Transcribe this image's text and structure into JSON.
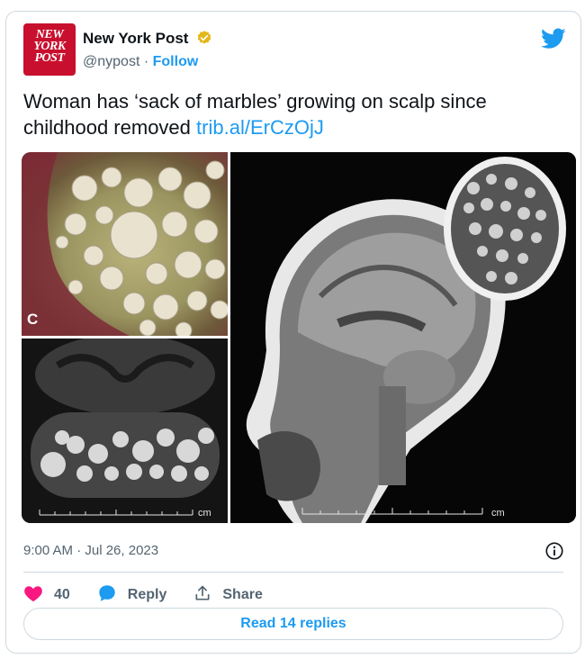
{
  "author": {
    "name": "New York Post",
    "handle": "@nypost",
    "separator": "·",
    "follow_label": "Follow",
    "avatar_text": [
      "NEW",
      "YORK",
      "POST"
    ]
  },
  "tweet": {
    "text": "Woman has ‘sack of marbles’ growing on scalp since childhood removed",
    "link": "trib.al/ErCzOjJ"
  },
  "media": {
    "panel_letter": "C",
    "scale_unit": "cm"
  },
  "meta": {
    "timestamp": "9:00 AM · Jul 26, 2023"
  },
  "actions": {
    "like_count": "40",
    "reply_label": "Reply",
    "share_label": "Share"
  },
  "read_replies_label": "Read 14 replies",
  "colors": {
    "accent": "#1d9bf0",
    "like": "#f91880",
    "brand_red": "#c8102e",
    "muted_text": "#536471"
  },
  "icons": [
    "verified-badge-icon",
    "twitter-bird-icon",
    "info-icon",
    "heart-icon",
    "reply-bubble-icon",
    "share-icon"
  ]
}
